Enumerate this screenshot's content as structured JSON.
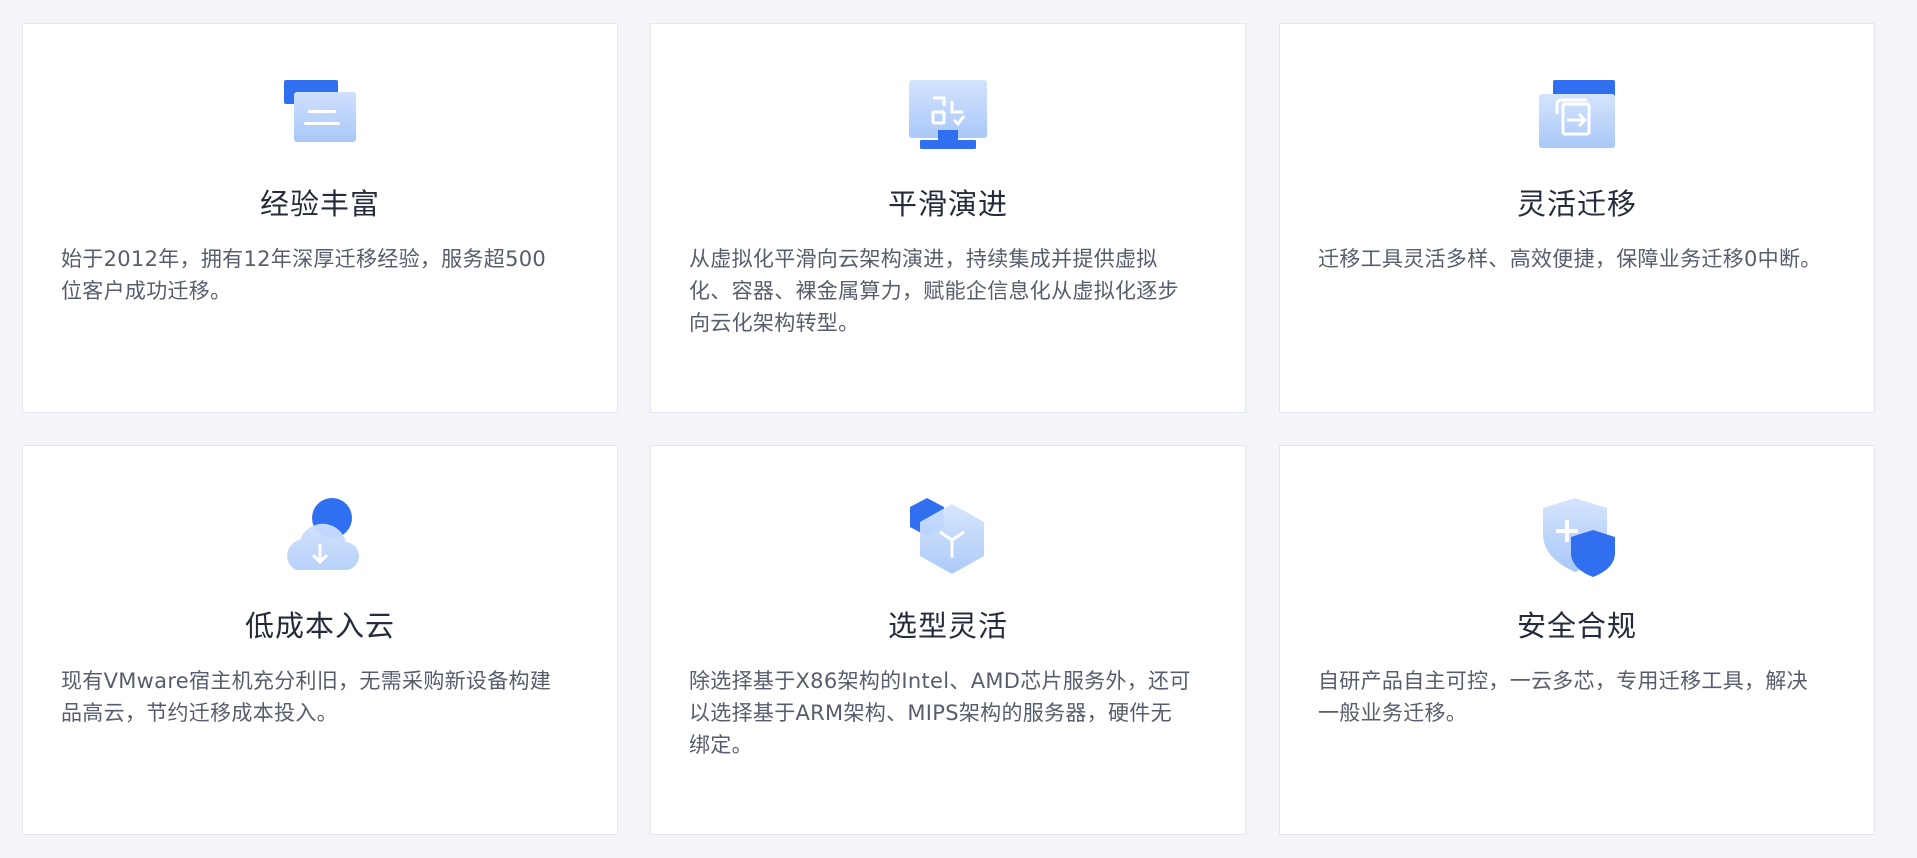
{
  "features": [
    {
      "title": "经验丰富",
      "description": "始于2012年，拥有12年深厚迁移经验，服务超500位客户成功迁移。",
      "icon": "document-window-icon"
    },
    {
      "title": "平滑演进",
      "description": "从虚拟化平滑向云架构演进，持续集成并提供虚拟化、容器、裸金属算力，赋能企信息化从虚拟化逐步向云化架构转型。",
      "icon": "monitor-grid-icon"
    },
    {
      "title": "灵活迁移",
      "description": "迁移工具灵活多样、高效便捷，保障业务迁移0中断。",
      "icon": "migrate-transfer-icon"
    },
    {
      "title": "低成本入云",
      "description": "现有VMware宿主机充分利旧，无需采购新设备构建品高云，节约迁移成本投入。",
      "icon": "cloud-download-icon"
    },
    {
      "title": "选型灵活",
      "description": "除选择基于X86架构的Intel、AMD芯片服务外，还可以选择基于ARM架构、MIPS架构的服务器，硬件无绑定。",
      "icon": "hexagon-chip-icon"
    },
    {
      "title": "安全合规",
      "description": "自研产品自主可控，一云多芯，专用迁移工具，解决一般业务迁移。",
      "icon": "shield-plus-icon"
    }
  ],
  "colors": {
    "primary": "#2f6ff0",
    "light": "#bcd6fb",
    "background": "#f3f5f8",
    "card": "#ffffff",
    "title": "#252b3a",
    "text": "#575d6c"
  }
}
